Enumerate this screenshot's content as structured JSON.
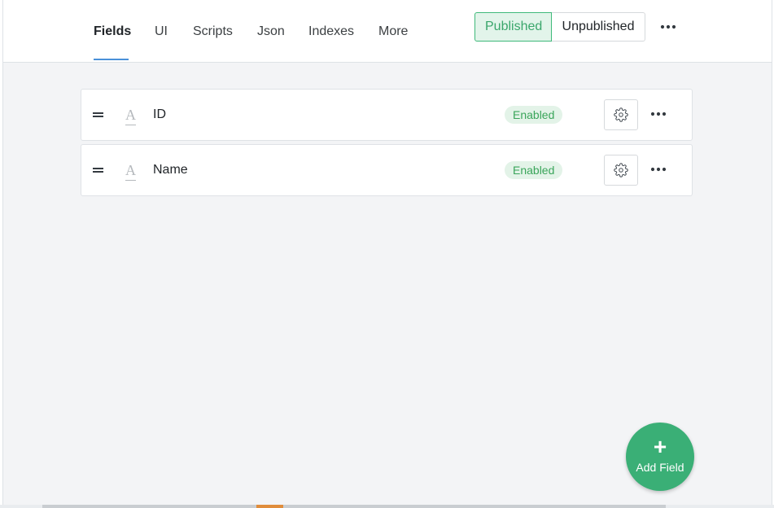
{
  "tabs": [
    {
      "label": "Fields",
      "active": true
    },
    {
      "label": "UI",
      "active": false
    },
    {
      "label": "Scripts",
      "active": false
    },
    {
      "label": "Json",
      "active": false
    },
    {
      "label": "Indexes",
      "active": false
    },
    {
      "label": "More",
      "active": false
    }
  ],
  "publish_toggle": {
    "published_label": "Published",
    "unpublished_label": "Unpublished",
    "selected": "Published"
  },
  "header_more_icon": "more-horizontal-icon",
  "fields": [
    {
      "name": "ID",
      "type_icon": "text-type-icon",
      "status": "Enabled"
    },
    {
      "name": "Name",
      "type_icon": "text-type-icon",
      "status": "Enabled"
    }
  ],
  "add_field_button": {
    "label": "Add Field",
    "icon": "plus-icon"
  },
  "colors": {
    "accent_green": "#3aaf76",
    "tab_underline": "#4a90d9",
    "badge_green": "#3aa55a",
    "content_bg": "#f3f4f6"
  }
}
